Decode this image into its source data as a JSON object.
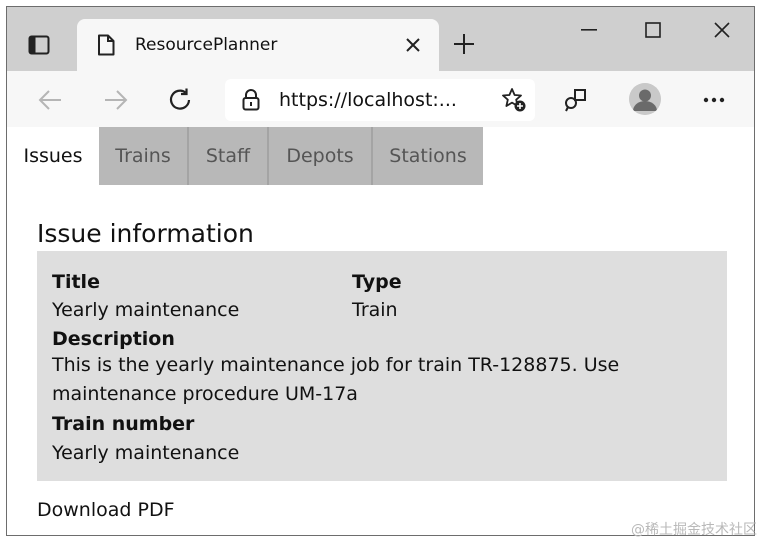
{
  "browser": {
    "tab_title": "ResourcePlanner",
    "url": "https://localhost:..."
  },
  "app": {
    "tabs": [
      {
        "label": "Issues",
        "active": true
      },
      {
        "label": "Trains",
        "active": false
      },
      {
        "label": "Staff",
        "active": false
      },
      {
        "label": "Depots",
        "active": false
      },
      {
        "label": "Stations",
        "active": false
      }
    ],
    "section_title": "Issue information",
    "fields": {
      "title_label": "Title",
      "title_value": "Yearly maintenance",
      "type_label": "Type",
      "type_value": "Train",
      "description_label": "Description",
      "description_value": "This is the yearly maintenance job for train TR-128875. Use maintenance procedure UM-17a",
      "train_number_label": "Train number",
      "train_number_value": "Yearly maintenance"
    },
    "download_label": "Download PDF"
  },
  "watermark": "@稀土掘金技术社区",
  "colors": {
    "tabstrip_bg": "#cfcfcf",
    "inactive_tab_bg": "#b8b8b8",
    "panel_bg": "#dedede"
  },
  "icons": [
    "tab-actions-icon",
    "page-icon",
    "close-icon",
    "plus-icon",
    "minimize-icon",
    "maximize-icon",
    "window-close-icon",
    "back-arrow-icon",
    "forward-arrow-icon",
    "refresh-icon",
    "lock-icon",
    "favorite-add-icon",
    "extensions-icon",
    "profile-icon",
    "more-icon"
  ]
}
